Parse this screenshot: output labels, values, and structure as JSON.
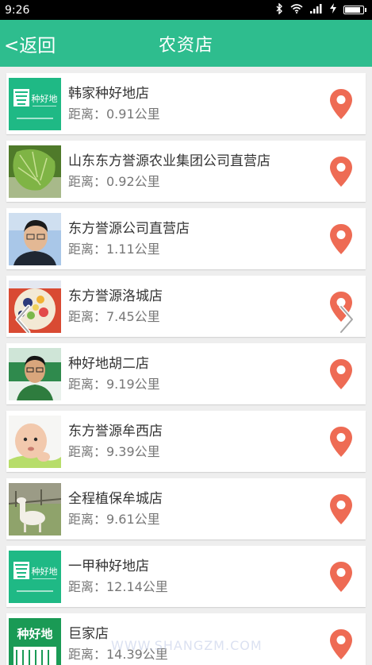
{
  "status_bar": {
    "time": "9:26"
  },
  "header": {
    "back_label": "<返回",
    "title": "农资店"
  },
  "stores": [
    {
      "name": "韩家种好地店",
      "distance": "距离：0.91公里",
      "thumb": "logo",
      "logo_text": "种好地"
    },
    {
      "name": "山东东方誉源农业集团公司直营店",
      "distance": "距离：0.92公里",
      "thumb": "leaf"
    },
    {
      "name": "东方誉源公司直营店",
      "distance": "距离：1.11公里",
      "thumb": "person"
    },
    {
      "name": "东方誉源洛城店",
      "distance": "距离：7.45公里",
      "thumb": "fruit"
    },
    {
      "name": "种好地胡二店",
      "distance": "距离：9.19公里",
      "thumb": "person2"
    },
    {
      "name": "东方誉源牟西店",
      "distance": "距离：9.39公里",
      "thumb": "baby"
    },
    {
      "name": "全程植保牟城店",
      "distance": "距离：9.61公里",
      "thumb": "alpaca"
    },
    {
      "name": "一甲种好地店",
      "distance": "距离：12.14公里",
      "thumb": "logo",
      "logo_text": "种好地"
    },
    {
      "name": "巨家店",
      "distance": "距离：14.39公里",
      "thumb": "logo2",
      "logo_text": "种好地"
    }
  ],
  "watermark": "WWW.SHANGZM.COM",
  "colors": {
    "header": "#2ebd8e",
    "pin": "#ee6b54",
    "background": "#eeeeee"
  },
  "icons": {
    "pin": "map-pin-icon",
    "prev": "chevron-left-icon",
    "next": "chevron-right-icon"
  }
}
